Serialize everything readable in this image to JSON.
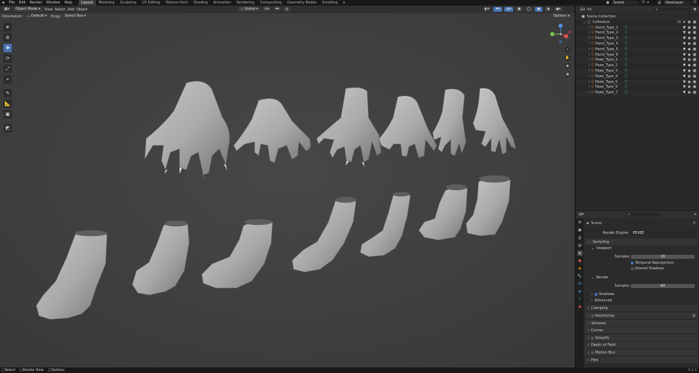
{
  "menu": [
    "File",
    "Edit",
    "Render",
    "Window",
    "Help"
  ],
  "workspaces": [
    "Layout",
    "Modeling",
    "Sculpting",
    "UV Editing",
    "Texture Paint",
    "Shading",
    "Animation",
    "Rendering",
    "Compositing",
    "Geometry Nodes",
    "Scripting"
  ],
  "active_workspace": "Layout",
  "scene_name": "Scene",
  "view_layer": "ViewLayer",
  "viewport_header": {
    "mode": "Object Mode",
    "menus": [
      "View",
      "Select",
      "Add",
      "Object"
    ],
    "transform_orientation": "Global",
    "options": "Options"
  },
  "tool_settings": {
    "orientation_label": "Orientation:",
    "orientation_value": "Default",
    "drag_label": "Drag:",
    "drag_value": "Select Box"
  },
  "outliner": {
    "root": "Scene Collection",
    "collection": "Collection",
    "items": [
      "Hand_Type_1",
      "Hand_Type_2",
      "Hand_Type_3",
      "Hand_Type_4",
      "Hand_Type_5",
      "Hand_Type_6",
      "Paws_Type_1",
      "Paws_Type_2",
      "Paws_Type_3",
      "Paws_Type_4",
      "Paws_Type_5",
      "Paws_Type_6",
      "Paws_Type_7"
    ]
  },
  "properties": {
    "context": "Scene",
    "render_engine_label": "Render Engine",
    "render_engine_value": "EEVEE",
    "sampling": "Sampling",
    "viewport": "Viewport",
    "samples_label": "Samples",
    "viewport_samples": "16",
    "temporal_reprojection": "Temporal Reprojection",
    "jittered_shadows": "Jittered Shadows",
    "render": "Render",
    "render_samples": "64",
    "shadows": "Shadows",
    "advanced": "Advanced",
    "sections": [
      "Clamping",
      "Raytracing",
      "Volumes",
      "Curves",
      "Simplify",
      "Depth of Field",
      "Motion Blur",
      "Film"
    ]
  },
  "status": [
    "Select",
    "Rotate View",
    "Options"
  ],
  "version": "4.2.1"
}
